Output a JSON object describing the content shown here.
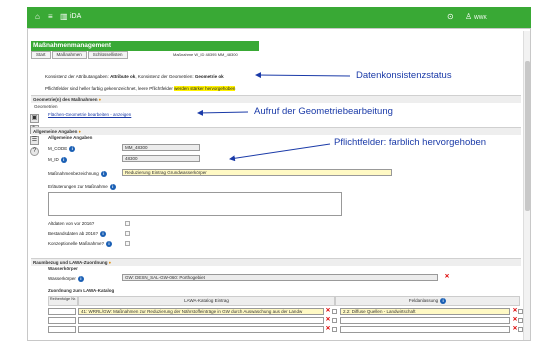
{
  "topbar": {
    "home_icon": "home-icon",
    "menu_icon": "hamburger-icon",
    "app_name": "iDA",
    "help_icon": "help-icon",
    "user_icon": "user-icon",
    "user_name": "WWK"
  },
  "panel": {
    "title": "Maßnahmenmanagement",
    "tabs": [
      "Start",
      "Maßnahmen",
      "Schlüssellisten"
    ],
    "id_info": "Maßnahme W_ID  48395 MM_48300"
  },
  "status": {
    "konsistenz_prefix": "Konsistenz der Attributangaben:",
    "konsistenz_attr": "Attribute ok",
    "konsistenz_geo_prefix": ", Konsistenz der Geometrien:",
    "konsistenz_geo": "Geometrie ok",
    "pflicht_prefix": "Pflichtfelder sind heller farbig gekennzeichnet, leere Pflichtfelder",
    "pflicht_highlight": "werden stärker hervorgehoben"
  },
  "sections": {
    "geometrie": "Geometrie(n) des Maßnahmen",
    "geometrien_sub": "Geometrien",
    "geo_link": "Flächen-Geometrie bearbeiten - anzeigen",
    "allgemein": "Allgemeine Angaben",
    "allgemein_sub": "Allgemeine Angaben",
    "raum": "Raumbezug und LAWA-Zuordnung",
    "wasserkoerper_sub": "Wasserkörper",
    "lawa_sub": "Zuordnung zum LAWA-Katalog"
  },
  "fields": {
    "m_code_label": "M_CODE",
    "m_code_value": "MM_48300",
    "m_id_label": "M_ID",
    "m_id_value": "48300",
    "bezeichnung_label": "Maßnahmenbezeichnung",
    "bezeichnung_value": "Reduzierung Eintrag Grundwasserkörper",
    "erlaeuterung_label": "Erläuterungen zur Maßnahme",
    "altdaten_label": "Altdaten von vor 2016?",
    "bestandsdaten_label": "Bestandsdaten ab 2016?",
    "konzept_label": "Konzeptionelle Maßnahme?",
    "wasserkoerper_label": "Wasserkörper",
    "wasserkoerper_value": "GW: DESN_SAL-GW-060: Porthogebiet"
  },
  "lawa": {
    "col_nr": "Reihenfolge Nr.",
    "col_katalog": "LAWA-Katalog Eintrag",
    "col_feld": "Feldanlassung",
    "row1_katalog": "41: WRRL/GW: Maßnahmen zur Reduzierung der  Nährstoffeinträge in GW durch Auswaschung aus der Landw",
    "row1_feld": "2.2: Diffuse Quellen - Landwirtschaft"
  },
  "annotations": {
    "datenkonsistenz": "Datenkonsistenzstatus",
    "geometrie": "Aufruf der Geometriebearbeitung",
    "pflicht": "Pflichtfelder: farblich hervorgehoben"
  },
  "colors": {
    "brand_green": "#39a935",
    "annotation_blue": "#1a3aa8",
    "required_yellow": "#fff9c4",
    "highlight_yellow": "#fff200"
  }
}
